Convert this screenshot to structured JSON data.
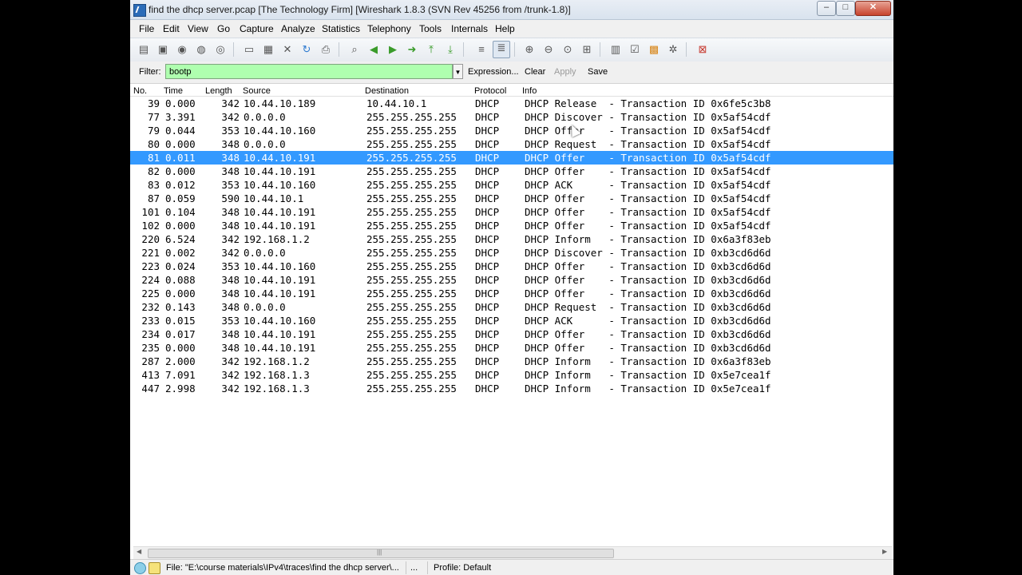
{
  "window": {
    "title": "find the dhcp server.pcap   [The Technology Firm]   [Wireshark 1.8.3  (SVN Rev 45256 from /trunk-1.8)]",
    "controls": {
      "minimize": "–",
      "maximize": "□",
      "close": "✕"
    }
  },
  "menu": [
    "File",
    "Edit",
    "View",
    "Go",
    "Capture",
    "Analyze",
    "Statistics",
    "Telephony",
    "Tools",
    "Internals",
    "Help"
  ],
  "filter": {
    "label": "Filter:",
    "value": "bootp",
    "expression": "Expression...",
    "clear": "Clear",
    "apply": "Apply",
    "save": "Save",
    "input_bg": "#afffaf"
  },
  "columns": [
    "No.",
    "Time",
    "Length",
    "Source",
    "Destination",
    "Protocol",
    "Info"
  ],
  "selected_row": 4,
  "selection_color": "#3399ff",
  "packets": [
    {
      "no": "39",
      "time": "0.000",
      "len": "342",
      "src": "10.44.10.189",
      "dst": "10.44.10.1",
      "proto": "DHCP",
      "info": "DHCP Release  - Transaction ID 0x6fe5c3b8"
    },
    {
      "no": "77",
      "time": "3.391",
      "len": "342",
      "src": "0.0.0.0",
      "dst": "255.255.255.255",
      "proto": "DHCP",
      "info": "DHCP Discover - Transaction ID 0x5af54cdf"
    },
    {
      "no": "79",
      "time": "0.044",
      "len": "353",
      "src": "10.44.10.160",
      "dst": "255.255.255.255",
      "proto": "DHCP",
      "info": "DHCP Offer    - Transaction ID 0x5af54cdf"
    },
    {
      "no": "80",
      "time": "0.000",
      "len": "348",
      "src": "0.0.0.0",
      "dst": "255.255.255.255",
      "proto": "DHCP",
      "info": "DHCP Request  - Transaction ID 0x5af54cdf"
    },
    {
      "no": "81",
      "time": "0.011",
      "len": "348",
      "src": "10.44.10.191",
      "dst": "255.255.255.255",
      "proto": "DHCP",
      "info": "DHCP Offer    - Transaction ID 0x5af54cdf"
    },
    {
      "no": "82",
      "time": "0.000",
      "len": "348",
      "src": "10.44.10.191",
      "dst": "255.255.255.255",
      "proto": "DHCP",
      "info": "DHCP Offer    - Transaction ID 0x5af54cdf"
    },
    {
      "no": "83",
      "time": "0.012",
      "len": "353",
      "src": "10.44.10.160",
      "dst": "255.255.255.255",
      "proto": "DHCP",
      "info": "DHCP ACK      - Transaction ID 0x5af54cdf"
    },
    {
      "no": "87",
      "time": "0.059",
      "len": "590",
      "src": "10.44.10.1",
      "dst": "255.255.255.255",
      "proto": "DHCP",
      "info": "DHCP Offer    - Transaction ID 0x5af54cdf"
    },
    {
      "no": "101",
      "time": "0.104",
      "len": "348",
      "src": "10.44.10.191",
      "dst": "255.255.255.255",
      "proto": "DHCP",
      "info": "DHCP Offer    - Transaction ID 0x5af54cdf"
    },
    {
      "no": "102",
      "time": "0.000",
      "len": "348",
      "src": "10.44.10.191",
      "dst": "255.255.255.255",
      "proto": "DHCP",
      "info": "DHCP Offer    - Transaction ID 0x5af54cdf"
    },
    {
      "no": "220",
      "time": "6.524",
      "len": "342",
      "src": "192.168.1.2",
      "dst": "255.255.255.255",
      "proto": "DHCP",
      "info": "DHCP Inform   - Transaction ID 0x6a3f83eb"
    },
    {
      "no": "221",
      "time": "0.002",
      "len": "342",
      "src": "0.0.0.0",
      "dst": "255.255.255.255",
      "proto": "DHCP",
      "info": "DHCP Discover - Transaction ID 0xb3cd6d6d"
    },
    {
      "no": "223",
      "time": "0.024",
      "len": "353",
      "src": "10.44.10.160",
      "dst": "255.255.255.255",
      "proto": "DHCP",
      "info": "DHCP Offer    - Transaction ID 0xb3cd6d6d"
    },
    {
      "no": "224",
      "time": "0.088",
      "len": "348",
      "src": "10.44.10.191",
      "dst": "255.255.255.255",
      "proto": "DHCP",
      "info": "DHCP Offer    - Transaction ID 0xb3cd6d6d"
    },
    {
      "no": "225",
      "time": "0.000",
      "len": "348",
      "src": "10.44.10.191",
      "dst": "255.255.255.255",
      "proto": "DHCP",
      "info": "DHCP Offer    - Transaction ID 0xb3cd6d6d"
    },
    {
      "no": "232",
      "time": "0.143",
      "len": "348",
      "src": "0.0.0.0",
      "dst": "255.255.255.255",
      "proto": "DHCP",
      "info": "DHCP Request  - Transaction ID 0xb3cd6d6d"
    },
    {
      "no": "233",
      "time": "0.015",
      "len": "353",
      "src": "10.44.10.160",
      "dst": "255.255.255.255",
      "proto": "DHCP",
      "info": "DHCP ACK      - Transaction ID 0xb3cd6d6d"
    },
    {
      "no": "234",
      "time": "0.017",
      "len": "348",
      "src": "10.44.10.191",
      "dst": "255.255.255.255",
      "proto": "DHCP",
      "info": "DHCP Offer    - Transaction ID 0xb3cd6d6d"
    },
    {
      "no": "235",
      "time": "0.000",
      "len": "348",
      "src": "10.44.10.191",
      "dst": "255.255.255.255",
      "proto": "DHCP",
      "info": "DHCP Offer    - Transaction ID 0xb3cd6d6d"
    },
    {
      "no": "287",
      "time": "2.000",
      "len": "342",
      "src": "192.168.1.2",
      "dst": "255.255.255.255",
      "proto": "DHCP",
      "info": "DHCP Inform   - Transaction ID 0x6a3f83eb"
    },
    {
      "no": "413",
      "time": "7.091",
      "len": "342",
      "src": "192.168.1.3",
      "dst": "255.255.255.255",
      "proto": "DHCP",
      "info": "DHCP Inform   - Transaction ID 0x5e7cea1f"
    },
    {
      "no": "447",
      "time": "2.998",
      "len": "342",
      "src": "192.168.1.3",
      "dst": "255.255.255.255",
      "proto": "DHCP",
      "info": "DHCP Inform   - Transaction ID 0x5e7cea1f"
    }
  ],
  "status": {
    "file": "File: \"E:\\course materials\\IPv4\\traces\\find the dhcp server\\...",
    "ellipsis": "...",
    "profile": "Profile: Default"
  },
  "toolbar_icons": [
    "interface-list-icon",
    "capture-options-icon",
    "start-capture-icon",
    "stop-capture-icon",
    "restart-capture-icon",
    "open-file-icon",
    "save-file-icon",
    "close-file-icon",
    "reload-icon",
    "print-icon",
    "find-packet-icon",
    "go-back-icon",
    "go-forward-icon",
    "go-to-packet-icon",
    "go-first-icon",
    "go-last-icon",
    "colorize-icon",
    "auto-scroll-icon",
    "zoom-in-icon",
    "zoom-out-icon",
    "normal-size-icon",
    "resize-columns-icon",
    "capture-filters-icon",
    "display-filters-icon",
    "coloring-rules-icon",
    "preferences-icon",
    "help-icon"
  ]
}
